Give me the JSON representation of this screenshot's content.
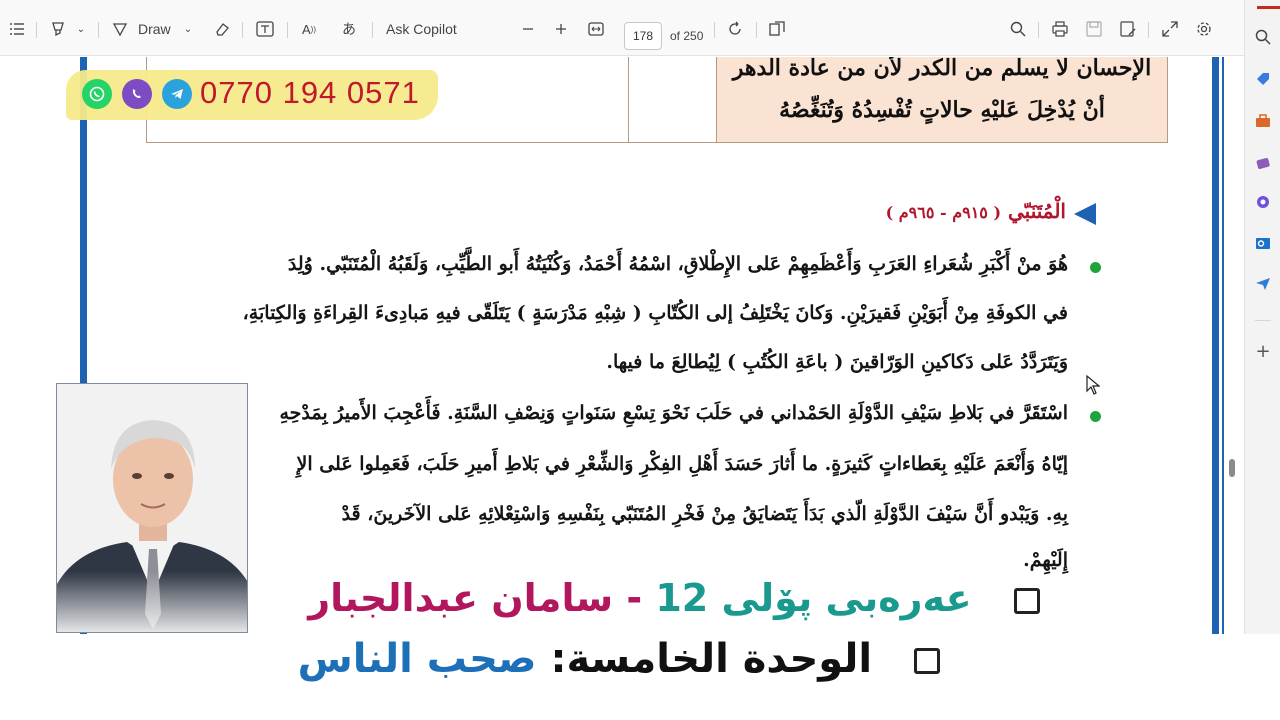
{
  "toolbar": {
    "draw_label": "Draw",
    "copilot_label": "Ask Copilot",
    "page_current": "178",
    "page_total": "of 250"
  },
  "table_top": {
    "verse_line_1": "الإحسان لا يسلم من الكدر لأن من عادة الدهر",
    "verse_line_2": "أنْ يُدْخِلَ عَليْهِ حالاتٍ تُفْسِدُهُ وَتُنَغِّصُهُ"
  },
  "heading": {
    "name": "الْمُتَنَبّي",
    "dates": "( ٩١٥م - ٩٦٥م )"
  },
  "paragraph_1": {
    "line_1": "هُوَ منْ أَكْبَرِ شُعَراءِ العَرَبِ وَأَعْظَمِهِمْ عَلى الإِطْلاقِ، اسْمُهُ أَحْمَدُ، وَكُنْيَتُهُ أَبو الطَّيِّبِ، وَلَقَبُهُ الْمُتَنَبّي. وُلِدَ",
    "line_2": "في الكوفَةِ مِنْ أَبَوَيْنِ فَقيرَيْنِ. وَكانَ يَخْتَلِفُ إلى الكُتّابِ ( شِبْهِ مَدْرَسَةٍ ) يَتَلَقّى فيهِ مَبادِىءَ القِراءَةِ وَالكِتابَةِ،",
    "line_3": "وَيَتَرَدَّدُ عَلى دَكاكينِ الوَرّاقينَ ( باعَةِ الكُتُبِ ) لِيُطالِعَ ما فيها."
  },
  "paragraph_2": {
    "line_1": "اسْتَقَرَّ في بَلاطِ سَيْفِ الدَّوْلَةِ الحَمْداني في حَلَبَ نَحْوَ تِسْعِ سَنَواتٍ وَنِصْفِ السَّنَةِ. فَأَعْجِبَ الأَميرُ بِمَدْحِهِ",
    "line_2": "إيّاهُ وَأَنْعَمَ عَلَيْهِ بِعَطاءاتٍ كَثيرَةٍ. ما أَثارَ حَسَدَ أَهْلِ الفِكْرِ وَالشِّعْرِ في بَلاطِ أَميرِ حَلَبَ، فَعَمِلوا عَلى الإِ",
    "line_3": "بِهِ. وَيَبْدو أَنَّ سَيْفَ الدَّوْلَةِ الّذي بَدَأَ يَتَضايَقُ مِنْ فَخْرِ المُتَنَبّي بِنَفْسِهِ وَاسْتِعْلائِهِ عَلى الآخَرينَ، قَدْ",
    "line_4": "إِلَيْهِمْ."
  },
  "banner": {
    "phone": "0770 194 0571"
  },
  "overlay": {
    "line1_part1": "عەرەبی پۆلی 12",
    "line1_dash": " - ",
    "line1_part2": "سامان عبدالجبار",
    "line2_part1": "الوحدة الخامسة:",
    "line2_part2": "صحب الناس"
  },
  "colors": {
    "accent_blue": "#1d62b3",
    "heading_red": "#b0162c",
    "bullet_green": "#1fa33b",
    "table_fill": "#fbe3d4",
    "banner_yellow": "#f6ea8a",
    "teal": "#1a9a8e",
    "magenta": "#b2175e"
  },
  "icons": [
    "list-icon",
    "highlight-icon",
    "draw-icon",
    "eraser-icon",
    "textbox-icon",
    "read-aloud-icon",
    "translate-icon",
    "minus-icon",
    "plus-icon",
    "fit-page-icon",
    "rotate-icon",
    "page-view-icon",
    "search-icon",
    "print-icon",
    "save-icon",
    "save-as-icon",
    "expand-icon",
    "settings-icon",
    "whatsapp-icon",
    "viber-icon",
    "telegram-icon"
  ]
}
